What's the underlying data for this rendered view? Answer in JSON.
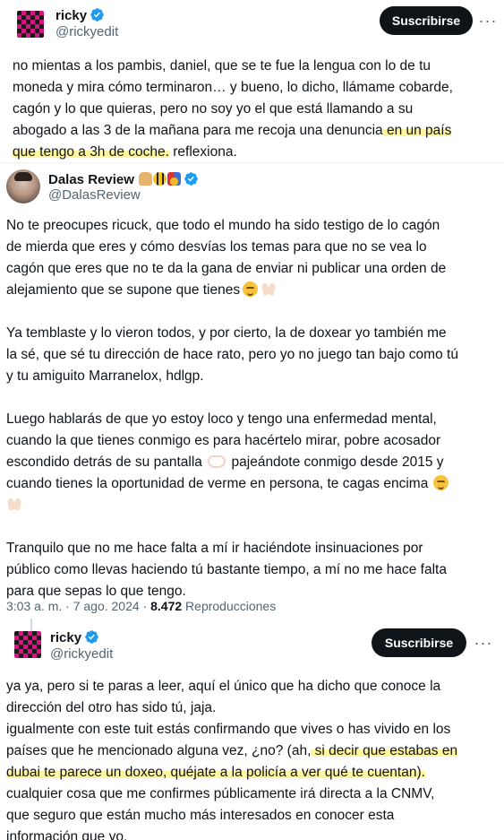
{
  "tweet1": {
    "name": "ricky",
    "handle": "@rickyedit",
    "subscribe": "Suscribirse",
    "more": "···",
    "lines": [
      "no mientas a los pambis, daniel, que se te fue la lengua con lo de tu",
      "moneda y mira cómo terminaron… y bueno, lo dicho, llámame cobarde,",
      "cagón y lo que quieras, pero no soy yo el que está llamando a su"
    ],
    "line4_pre": "abogado a las 3 de la mañana para me recoja una denuncia",
    "line4_hl": " en un país",
    "line5_hl": "que tengo a 3h de coche.",
    "line5_post": " reflexiona."
  },
  "tweet2": {
    "name": "Dalas Review",
    "handle": "@DalasReview",
    "p1": [
      "No te preocupes ricuck, que todo el mundo ha sido testigo de lo cagón",
      "de mierda que eres y cómo desvías los temas para que no se vea lo",
      "cagón que eres que no te da la gana de enviar ni publicar una orden de",
      "alejamiento que se supone que tienes"
    ],
    "p2": [
      "Ya temblaste y lo vieron todos, y por cierto, la de doxear yo también me",
      "la sé, que sé tu dirección de hace rato, pero yo no juego tan bajo como tú",
      "y tu amiguito Marranelox, hdlgp."
    ],
    "p3": [
      "Luego hablarás de que yo estoy loco y tengo una enfermedad mental,",
      "cuando la que tienes conmigo es para hacértelo mirar, pobre acosador"
    ],
    "p3_l3_pre": "escondido detrás de su pantalla",
    "p3_l3_post": "pajeándote conmigo desde 2015 y",
    "p3_l4": "cuando tienes la oportunidad de verme en persona, te cagas encima",
    "p4": [
      "Tranquilo que no me hace falta a mí ir haciéndote insinuaciones por",
      "público como llevas haciendo tú bastante tiempo, a mí no me hace falta",
      "para que sepas lo que tengo."
    ],
    "time": "3:03 a. m. · 7 ago. 2024 · ",
    "views": "8.472",
    "views_label": " Reproducciones"
  },
  "tweet3": {
    "name": "ricky",
    "handle": "@rickyedit",
    "subscribe": "Suscribirse",
    "more": "···",
    "lines": [
      "ya ya, pero si te paras a leer, aquí el único que ha dicho que conoce la",
      "dirección del otro has sido tú, jaja.",
      "igualmente con este tuit estás confirmando que vives o has vivido en los"
    ],
    "l4_pre": "países que he mencionado alguna vez, ¿no? (ah,",
    "l4_hl": " si decir que estabas en",
    "l5_hl": "dubai te parece un doxeo, quéjate a la policía a ver qué te cuentan).",
    "tail": [
      "cualquier cosa que me confirmes públicamente irá directa a la CNMV,",
      "que seguro que están mucho más interesados en conocer esta",
      "información que yo."
    ]
  },
  "colors": {
    "verified": "#1d9bf0",
    "highlight": "#fff59d",
    "text": "#0f1419",
    "muted": "#536471"
  }
}
